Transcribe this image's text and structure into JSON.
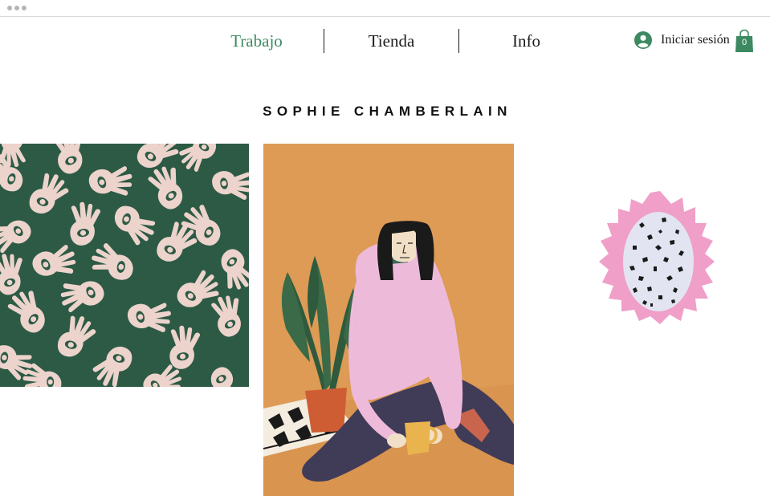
{
  "nav": {
    "items": [
      {
        "label": "Trabajo",
        "active": true
      },
      {
        "label": "Tienda",
        "active": false
      },
      {
        "label": "Info",
        "active": false
      }
    ]
  },
  "account": {
    "login_label": "Iniciar sesión",
    "cart_count": "0"
  },
  "site": {
    "title": "SOPHIE CHAMBERLAIN"
  },
  "colors": {
    "accent": "#3d8a62",
    "pattern_bg": "#2c5a45",
    "pattern_hand": "#ecd3cc",
    "portrait_bg": "#dd9b55",
    "sweater": "#eebada",
    "dragonfruit_pink": "#ef9fc8"
  },
  "gallery": {
    "items": [
      {
        "icon": "hands-pattern-artwork"
      },
      {
        "icon": "woman-with-plant-artwork"
      },
      {
        "icon": "dragon-fruit-artwork"
      }
    ]
  }
}
